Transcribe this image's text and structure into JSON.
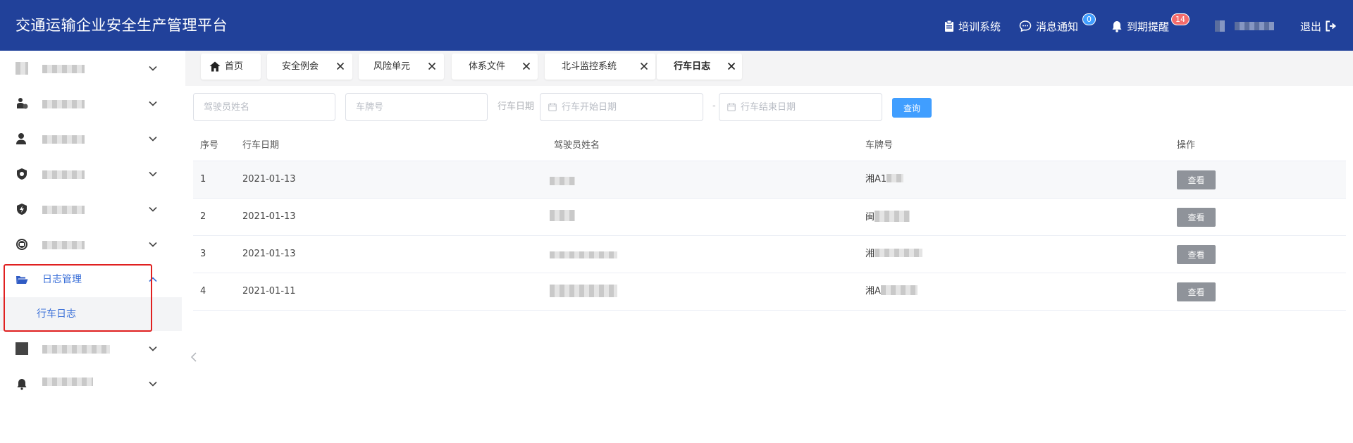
{
  "header": {
    "title": "交通运输企业安全生产管理平台",
    "training": "培训系统",
    "messages": "消息通知",
    "messages_count": "0",
    "expiry": "到期提醒",
    "expiry_count": "14",
    "logout": "退出",
    "icons": [
      "clipboard-icon",
      "chat-bubble-icon",
      "bell-icon",
      "logout-icon"
    ]
  },
  "sidebar": {
    "open_menu": "日志管理",
    "open_submenu_item": "行车日志",
    "icons": [
      "menu-icon-1",
      "safety-person-icon",
      "user-icon",
      "shield-gear-icon",
      "lightning-shield-icon",
      "danger-badge-icon",
      "folder-open-icon",
      "square-icon",
      "bell-icon"
    ]
  },
  "tabs": [
    {
      "label": "首页",
      "icon": "home-icon",
      "closable": false
    },
    {
      "label": "安全例会",
      "closable": true
    },
    {
      "label": "风险单元",
      "closable": true
    },
    {
      "label": "体系文件",
      "closable": true
    },
    {
      "label": "北斗监控系统",
      "closable": true
    },
    {
      "label": "行车日志",
      "closable": true,
      "active": true
    }
  ],
  "filters": {
    "driver_placeholder": "驾驶员姓名",
    "plate_placeholder": "车牌号",
    "date_label": "行车日期",
    "start_placeholder": "行车开始日期",
    "end_placeholder": "行车结束日期",
    "separator": "-",
    "query_button": "查询"
  },
  "table": {
    "columns": [
      "序号",
      "行车日期",
      "驾驶员姓名",
      "车牌号",
      "操作"
    ],
    "rows": [
      {
        "no": "1",
        "date": "2021-01-13",
        "plate": "湘A1",
        "action": "查看"
      },
      {
        "no": "2",
        "date": "2021-01-13",
        "plate": "闽",
        "action": "查看"
      },
      {
        "no": "3",
        "date": "2021-01-13",
        "plate": "湘",
        "action": "查看"
      },
      {
        "no": "4",
        "date": "2021-01-11",
        "plate": "湘A",
        "action": "查看"
      }
    ]
  },
  "colors": {
    "header_bg": "#21419a",
    "accent": "#409eff",
    "menu_active": "#3a6fd8",
    "highlight": "#e02020",
    "badge_red": "#f56c6c"
  }
}
